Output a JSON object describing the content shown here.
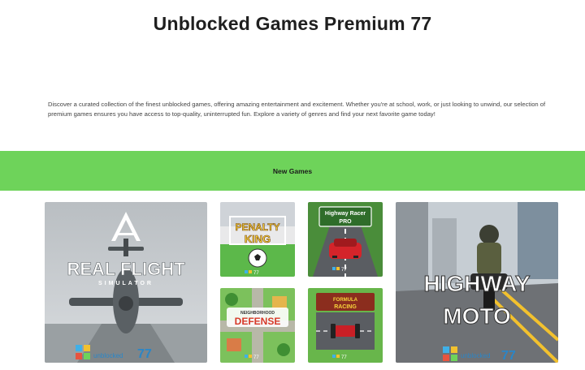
{
  "header": {
    "title": "Unblocked Games Premium 77"
  },
  "intro": {
    "text": "Discover a curated collection of the finest unblocked games, offering amazing entertainment and excitement. Whether you're at school, work, or just looking to unwind, our selection of premium games ensures you have access to top-quality, uninterrupted fun. Explore a variety of genres and find your next favorite game today!"
  },
  "section": {
    "label": "New Games",
    "color": "#6ed35a"
  },
  "games": [
    {
      "title_line1": "REAL FLIGHT",
      "title_line2": "SIMULATOR",
      "logo_number": "77"
    },
    {
      "title_line1": "PENALTY",
      "title_line2": "KING",
      "logo_number": "77"
    },
    {
      "title_line1": "Highway Racer",
      "title_line2": "PRO",
      "logo_number": "77"
    },
    {
      "title_line1": "NEIGHBORHOOD",
      "title_line2": "DEFENSE",
      "logo_number": "77"
    },
    {
      "title_line1": "FORMULA",
      "title_line2": "RACING",
      "logo_number": "77"
    },
    {
      "title_line1": "HIGHWAY",
      "title_line2": "MOTO",
      "logo_number": "77"
    }
  ]
}
